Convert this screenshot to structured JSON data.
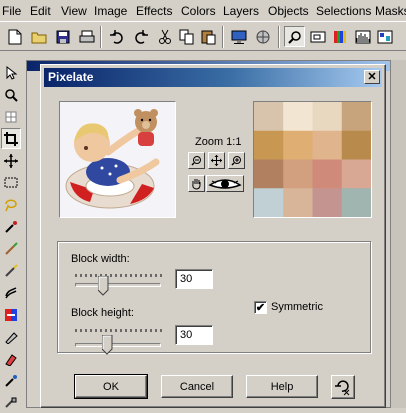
{
  "menubar": {
    "items": [
      "File",
      "Edit",
      "View",
      "Image",
      "Effects",
      "Colors",
      "Layers",
      "Objects",
      "Selections",
      "Masks"
    ]
  },
  "dialog": {
    "title": "Pixelate",
    "zoom_label": "Zoom 1:1",
    "block_width": {
      "label": "Block width:",
      "value": "30",
      "slider_position": 0.33
    },
    "block_height": {
      "label": "Block height:",
      "value": "30",
      "slider_position": 0.37
    },
    "symmetric": {
      "label": "Symmetric",
      "checked": true
    },
    "buttons": {
      "ok": "OK",
      "cancel": "Cancel",
      "help": "Help"
    }
  },
  "mosaic_colors": [
    [
      "#d8c4ac",
      "#f2e6d2",
      "#e8d8c0",
      "#c8a47c"
    ],
    [
      "#c89852",
      "#dfae72",
      "#e0b48c",
      "#b88a4c"
    ],
    [
      "#b08060",
      "#d2a07e",
      "#cf8a7a",
      "#d8a894"
    ],
    [
      "#c0d0d4",
      "#d8b498",
      "#c49490",
      "#a0b4b0"
    ]
  ],
  "colors": {
    "title_start": "#0a246a",
    "title_end": "#a6caf0",
    "face": "#d4d0c8"
  }
}
